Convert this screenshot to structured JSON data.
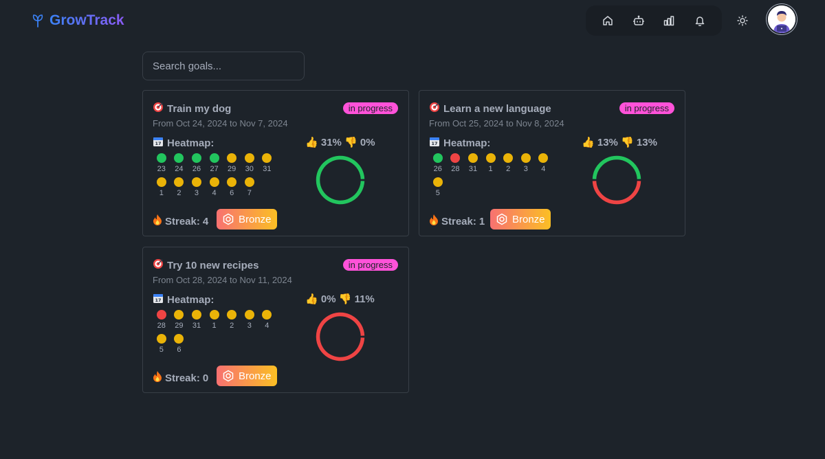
{
  "app": {
    "brand": "GrowTrack"
  },
  "nav": {
    "icons": [
      "home-icon",
      "bot-icon",
      "chart-icon",
      "bell-icon"
    ],
    "theme_icon": "sun-icon"
  },
  "search": {
    "placeholder": "Search goals...",
    "value": ""
  },
  "labels": {
    "heatmap": "Heatmap:",
    "streak_prefix": "Streak:"
  },
  "colors": {
    "good": "#22c55e",
    "mid": "#eab308",
    "bad": "#ef4444",
    "badge": "#ff52d9",
    "brand_from": "#3b82f6",
    "brand_to": "#8b5cf6"
  },
  "goals": [
    {
      "title": "Train my dog",
      "status": "in progress",
      "dates": "From Oct 24, 2024 to Nov 7, 2024",
      "up_text": "31%",
      "down_text": "0%",
      "up_pct": 31,
      "down_pct": 0,
      "heatmap": [
        {
          "day": "23",
          "s": "good"
        },
        {
          "day": "24",
          "s": "good"
        },
        {
          "day": "26",
          "s": "good"
        },
        {
          "day": "27",
          "s": "good"
        },
        {
          "day": "29",
          "s": "mid"
        },
        {
          "day": "30",
          "s": "mid"
        },
        {
          "day": "31",
          "s": "mid"
        },
        {
          "day": "1",
          "s": "mid"
        },
        {
          "day": "2",
          "s": "mid"
        },
        {
          "day": "3",
          "s": "mid"
        },
        {
          "day": "4",
          "s": "mid"
        },
        {
          "day": "6",
          "s": "mid"
        },
        {
          "day": "7",
          "s": "mid"
        }
      ],
      "streak_count": "4",
      "badge": "Bronze"
    },
    {
      "title": "Learn a new language",
      "status": "in progress",
      "dates": "From Oct 25, 2024 to Nov 8, 2024",
      "up_text": "13%",
      "down_text": "13%",
      "up_pct": 13,
      "down_pct": 13,
      "heatmap": [
        {
          "day": "26",
          "s": "good"
        },
        {
          "day": "28",
          "s": "bad"
        },
        {
          "day": "31",
          "s": "mid"
        },
        {
          "day": "1",
          "s": "mid"
        },
        {
          "day": "2",
          "s": "mid"
        },
        {
          "day": "3",
          "s": "mid"
        },
        {
          "day": "4",
          "s": "mid"
        },
        {
          "day": "5",
          "s": "mid"
        }
      ],
      "streak_count": "1",
      "badge": "Bronze"
    },
    {
      "title": "Try 10 new recipes",
      "status": "in progress",
      "dates": "From Oct 28, 2024 to Nov 11, 2024",
      "up_text": "0%",
      "down_text": "11%",
      "up_pct": 0,
      "down_pct": 11,
      "heatmap": [
        {
          "day": "28",
          "s": "bad"
        },
        {
          "day": "29",
          "s": "mid"
        },
        {
          "day": "31",
          "s": "mid"
        },
        {
          "day": "1",
          "s": "mid"
        },
        {
          "day": "2",
          "s": "mid"
        },
        {
          "day": "3",
          "s": "mid"
        },
        {
          "day": "4",
          "s": "mid"
        },
        {
          "day": "5",
          "s": "mid"
        },
        {
          "day": "6",
          "s": "mid"
        }
      ],
      "streak_count": "0",
      "badge": "Bronze"
    }
  ]
}
